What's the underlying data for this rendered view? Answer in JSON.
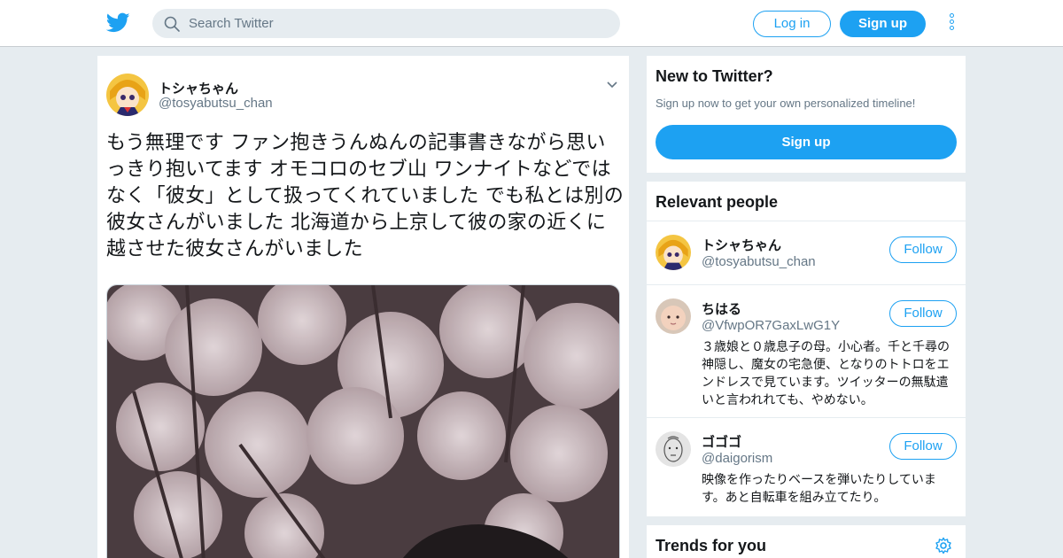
{
  "header": {
    "logo_icon": "twitter-bird-icon",
    "search_placeholder": "Search Twitter",
    "login_label": "Log in",
    "signup_label": "Sign up",
    "brand_color": "#1da1f2"
  },
  "tweet": {
    "author_name": "トシャちゃん",
    "author_handle": "@tosyabutsu_chan",
    "text": "もう無理です ファン抱きうんぬんの記事書きながら思いっきり抱いてます オモコロのセブ山 ワンナイトなどではなく「彼女」として扱ってくれていました でも私とは別の彼女さんがいました 北海道から上京して彼の家の近くに越させた彼女さんがいました",
    "media_description_icon": "photo-media"
  },
  "new_to_twitter": {
    "title": "New to Twitter?",
    "subtitle": "Sign up now to get your own personalized timeline!",
    "button_label": "Sign up"
  },
  "relevant_people": {
    "title": "Relevant people",
    "follow_label": "Follow",
    "people": [
      {
        "name": "トシャちゃん",
        "handle": "@tosyabutsu_chan",
        "bio": ""
      },
      {
        "name": "ちはる",
        "handle": "@VfwpOR7GaxLwG1Y",
        "bio": "３歳娘と０歳息子の母。小心者。千と千尋の神隠し、魔女の宅急便、となりのトトロをエンドレスで見ています。ツイッターの無駄遣いと言われれても、やめない。"
      },
      {
        "name": "ゴゴゴ",
        "handle": "@daigorism",
        "bio": "映像を作ったりベースを弾いたりしています。あと自転車を組み立てたり。"
      }
    ]
  },
  "trends": {
    "title": "Trends for you",
    "settings_icon": "gear-icon"
  }
}
